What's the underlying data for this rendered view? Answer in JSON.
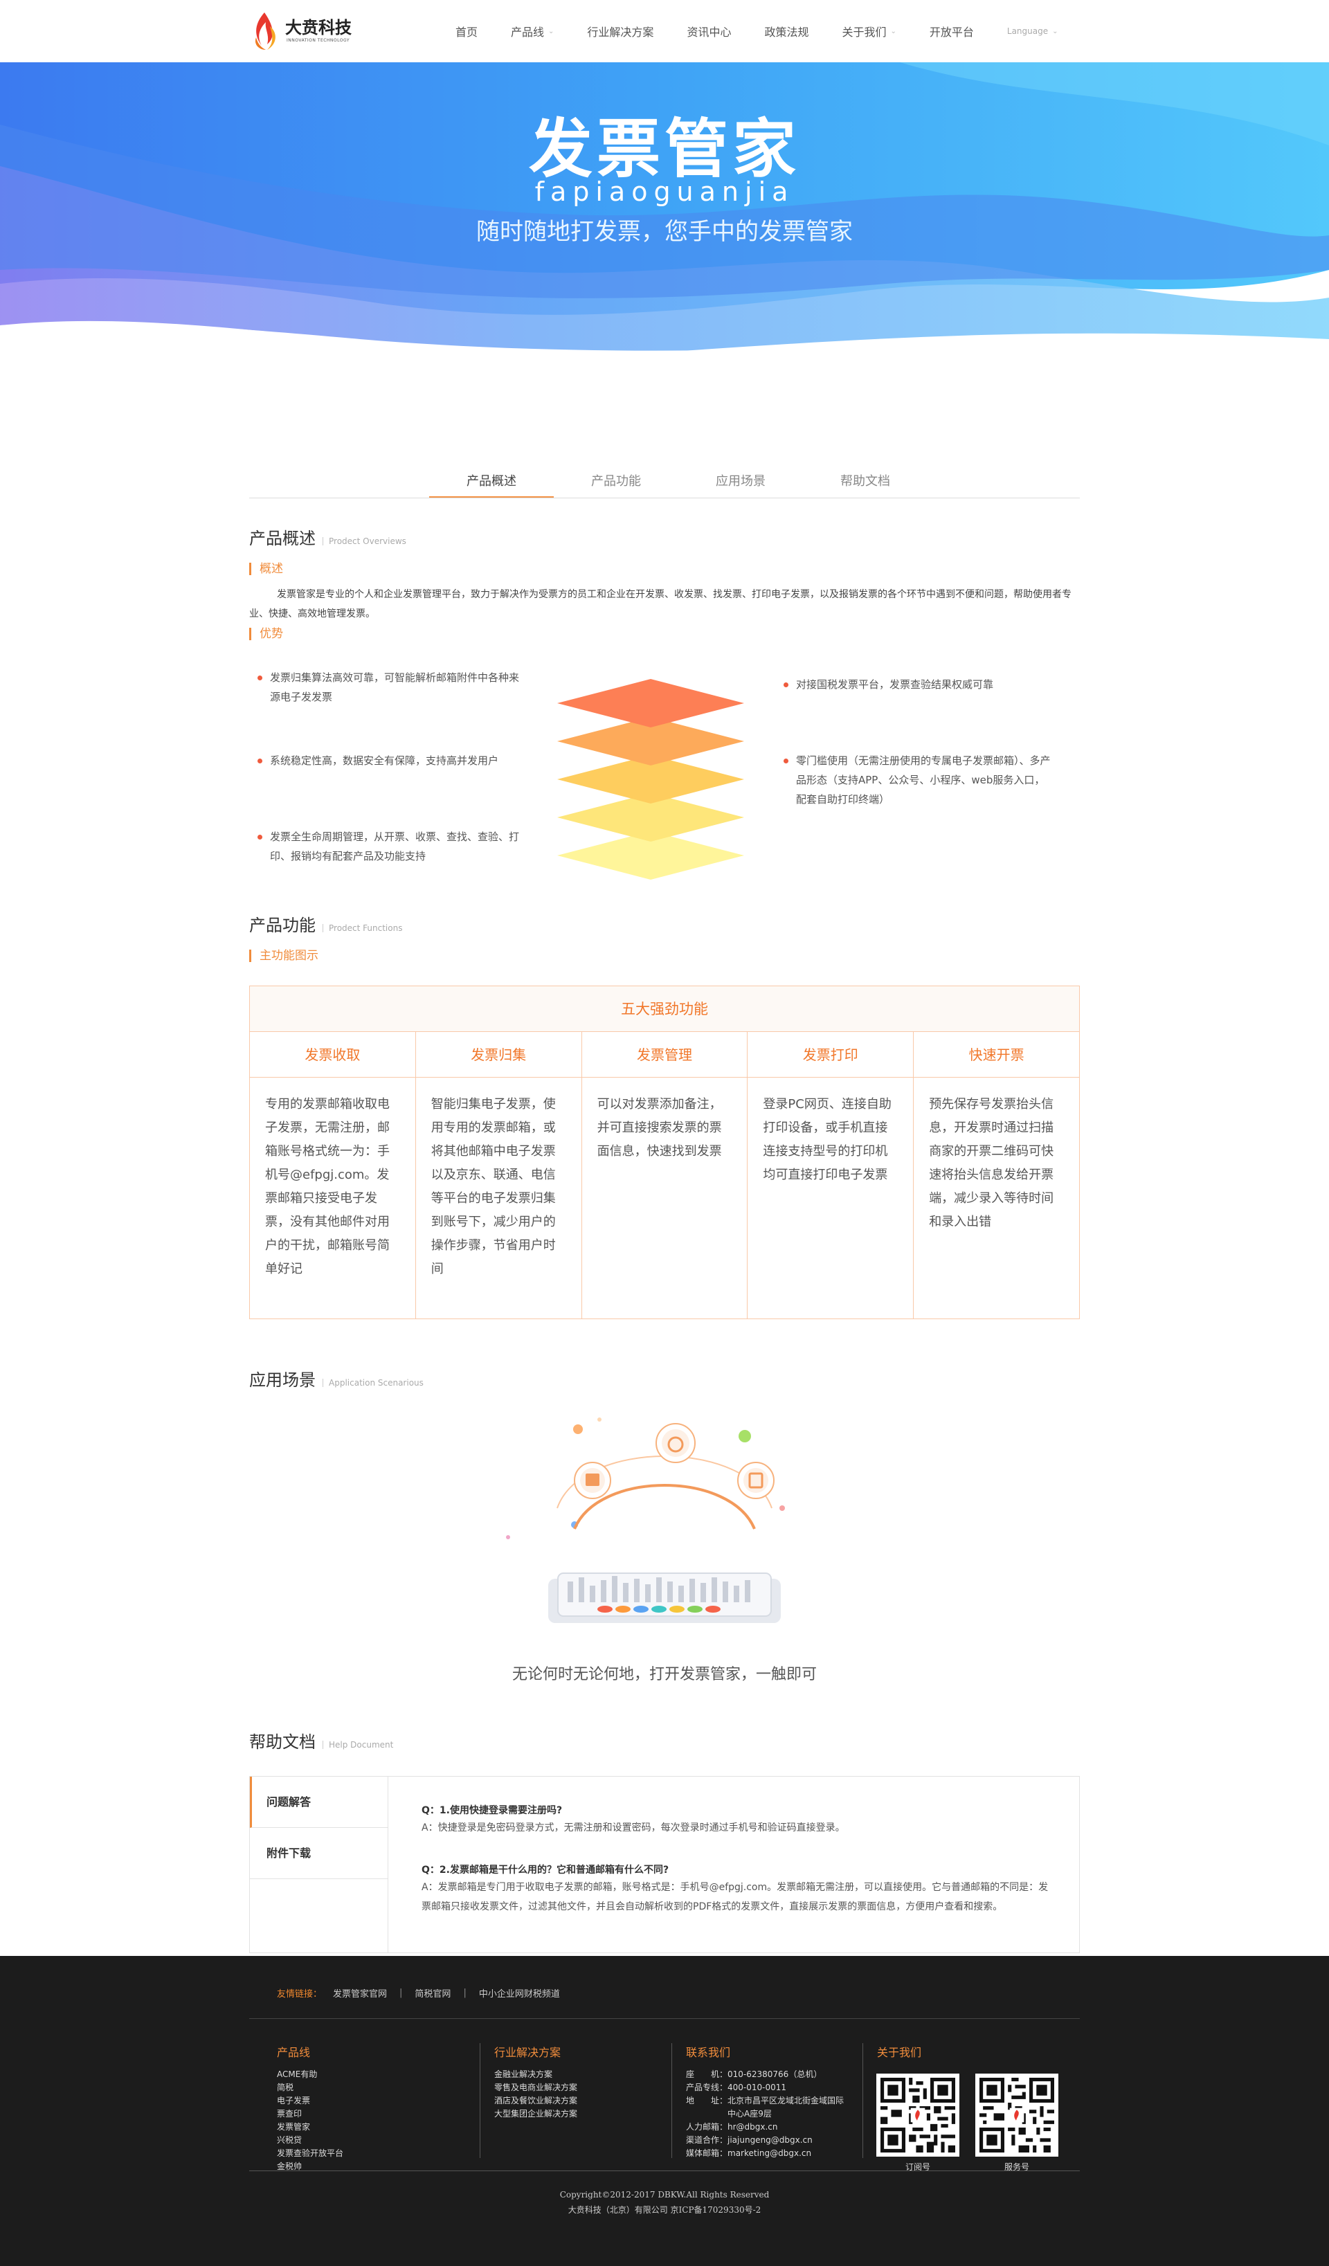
{
  "header": {
    "logo_text": "大贲科技",
    "logo_sub": "INNOVATION TECHNOLOGY",
    "nav": [
      {
        "label": "首页",
        "dropdown": false
      },
      {
        "label": "产品线",
        "dropdown": true
      },
      {
        "label": "行业解决方案",
        "dropdown": false
      },
      {
        "label": "资讯中心",
        "dropdown": false
      },
      {
        "label": "政策法规",
        "dropdown": false
      },
      {
        "label": "关于我们",
        "dropdown": true
      },
      {
        "label": "开放平台",
        "dropdown": false
      }
    ],
    "language": "Language"
  },
  "hero": {
    "title": "发票管家",
    "pinyin": "fapiaoguanjia",
    "slogan": "随时随地打发票，您手中的发票管家"
  },
  "tabs": [
    "产品概述",
    "产品功能",
    "应用场景",
    "帮助文档"
  ],
  "overview": {
    "title": "产品概述",
    "title_en": "Prodect Overviews",
    "sub1": "概述",
    "text": "发票管家是专业的个人和企业发票管理平台，致力于解决作为受票方的员工和企业在开发票、收发票、找发票、打印电子发票，以及报销发票的各个环节中遇到不便和问题，帮助使用者专业、快捷、高效地管理发票。",
    "sub2": "优势",
    "advantages_left": [
      "发票归集算法高效可靠，可智能解析邮箱附件中各种来源电子发发票",
      "系统稳定性高，数据安全有保障，支持高并发用户",
      "发票全生命周期管理，从开票、收票、查找、查验、打印、报销均有配套产品及功能支持"
    ],
    "advantages_right": [
      "对接国税发票平台，发票查验结果权威可靠",
      "零门槛使用（无需注册使用的专属电子发票邮箱）、多产品形态（支持APP、公众号、小程序、web服务入口，配套自助打印终端）"
    ]
  },
  "functions": {
    "title": "产品功能",
    "title_en": "Prodect Functions",
    "sub": "主功能图示",
    "table_head": "五大强劲功能",
    "columns": [
      {
        "name": "发票收取",
        "desc": "专用的发票邮箱收取电子发票，无需注册，邮箱账号格式统一为：手机号@efpgj.com。发票邮箱只接受电子发票，没有其他邮件对用户的干扰，邮箱账号简单好记"
      },
      {
        "name": "发票归集",
        "desc": "智能归集电子发票，使用专用的发票邮箱，或将其他邮箱中电子发票以及京东、联通、电信等平台的电子发票归集到账号下，减少用户的操作步骤，节省用户时间"
      },
      {
        "name": "发票管理",
        "desc": "可以对发票添加备注，并可直接搜索发票的票面信息，快速找到发票"
      },
      {
        "name": "发票打印",
        "desc": "登录PC网页、连接自助打印设备，或手机直接连接支持型号的打印机均可直接打印电子发票"
      },
      {
        "name": "快速开票",
        "desc": "预先保存号发票抬头信息，开发票时通过扫描商家的开票二维码可快速将抬头信息发给开票端，减少录入等待时间和录入出错"
      }
    ]
  },
  "scenes": {
    "title": "应用场景",
    "title_en": "Application Scenarious",
    "caption": "无论何时无论何地，打开发票管家，一触即可"
  },
  "help": {
    "title": "帮助文档",
    "title_en": "Help Document",
    "side": [
      "问题解答",
      "附件下载"
    ],
    "qa": [
      {
        "q": "Q：1.使用快捷登录需要注册吗?",
        "a": "A：快捷登录是免密码登录方式，无需注册和设置密码，每次登录时通过手机号和验证码直接登录。"
      },
      {
        "q": "Q：2.发票邮箱是干什么用的？它和普通邮箱有什么不同?",
        "a": "A：发票邮箱是专门用于收取电子发票的邮箱，账号格式是：手机号@efpgj.com。发票邮箱无需注册，可以直接使用。它与普通邮箱的不同是：发票邮箱只接收发票文件，过滤其他文件，并且会自动解析收到的PDF格式的发票文件，直接展示发票的票面信息，方便用户查看和搜索。"
      }
    ]
  },
  "footer": {
    "friend_label": "友情链接：",
    "friend_links": [
      "发票管家官网",
      "简税官网",
      "中小企业网财税频道"
    ],
    "products": {
      "title": "产品线",
      "items": [
        "ACME有助",
        "简税",
        "电子发票",
        "票查印",
        "发票管家",
        "兴税贷",
        "发票查验开放平台",
        "金税帅"
      ]
    },
    "solutions": {
      "title": "行业解决方案",
      "items": [
        "金融业解决方案",
        "零售及电商业解决方案",
        "酒店及餐饮业解决方案",
        "大型集团企业解决方案"
      ]
    },
    "contact": {
      "title": "联系我们",
      "items": [
        "座　　机：010-62380766（总机）",
        "产品专线：400-010-0011",
        "地　　址：北京市昌平区龙域北街金域国际",
        "　　　　　中心A座9层",
        "人力邮箱：hr@dbgx.cn",
        "渠道合作：jiajungeng@dbgx.cn",
        "媒体邮箱：marketing@dbgx.cn"
      ]
    },
    "about": {
      "title": "关于我们",
      "qr1": "订阅号",
      "qr2": "服务号"
    },
    "copyright": "Copyright©2012-2017 DBKW.All Rights Reserved",
    "icp": "大贲科技（北京）有限公司 京ICP备17029330号-2"
  }
}
